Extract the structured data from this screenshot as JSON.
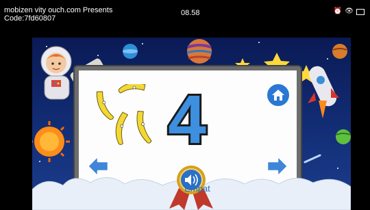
{
  "status": {
    "watermark_line1": "mobizen vity ouch.com Presents",
    "watermark_code": "Code:7fd60807",
    "time": "08.58"
  },
  "game": {
    "number_value": "4",
    "number_word": "Empat",
    "item_count": 4,
    "item_name": "banana",
    "colors": {
      "sky": "#0f2466",
      "number_fill": "#3d8fe0",
      "number_outline": "#1a1a1a",
      "arrow": "#3f86d8",
      "ribbon": "#c0392b"
    },
    "icons": [
      "home-icon",
      "arrow-left-icon",
      "arrow-right-icon",
      "speaker-icon"
    ]
  }
}
